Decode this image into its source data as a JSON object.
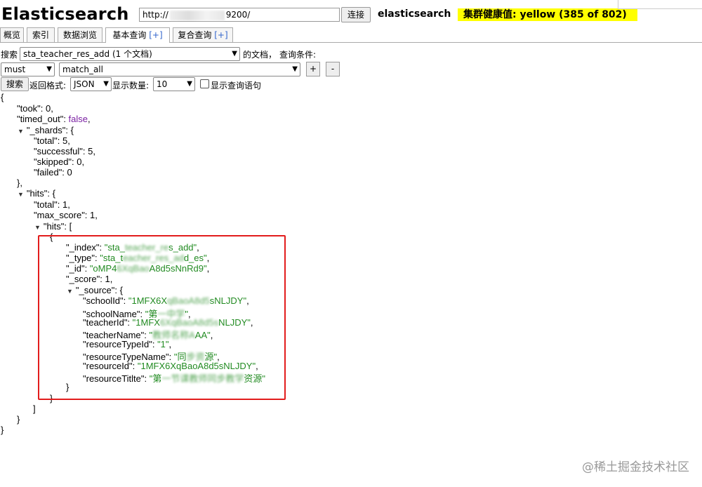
{
  "header": {
    "logo": "Elasticsearch",
    "url_prefix": "http://",
    "url_suffix": "9200/",
    "connect_label": "连接",
    "cluster_name": "elasticsearch",
    "health_text": "集群健康值: yellow (385 of 802)"
  },
  "tabs": [
    {
      "label": "概览"
    },
    {
      "label": "索引"
    },
    {
      "label": "数据浏览"
    },
    {
      "label": "基本查询",
      "plus": "[+]"
    },
    {
      "label": "复合查询",
      "plus": "[+]"
    }
  ],
  "query": {
    "search_label": "搜索",
    "index_value": "sta_teacher_res_add (1 个文档)",
    "docs_label": "的文档，",
    "conditions_label": "查询条件:",
    "bool_value": "must",
    "match_value": "match_all",
    "add_label": "+",
    "remove_label": "-",
    "search_button": "搜索",
    "format_label": "返回格式:",
    "format_value": "JSON",
    "count_label": "显示数量:",
    "count_value": "10",
    "show_query_label": "显示查询语句"
  },
  "result": {
    "took": "0",
    "timed_out": "false",
    "shards": {
      "total": "5",
      "successful": "5",
      "skipped": "0",
      "failed": "0"
    },
    "hits_total": "1",
    "max_score": "1",
    "hit": {
      "index_a": "\"sta_",
      "index_b": "s_add\"",
      "type_a": "\"sta_t",
      "type_b": "d_es\"",
      "id_a": "\"oMP4",
      "id_b": "A8d5sNnRd9\"",
      "score": "1",
      "source": {
        "schoolId_a": "\"1MFX6X",
        "schoolId_b": "sNLJDY\"",
        "schoolName_a": "\"第",
        "schoolName_b": "\"",
        "teacherId_a": "\"1MFX",
        "teacherId_b": "NLJDY\"",
        "teacherName_a": "\"",
        "teacherName_b": "AA\"",
        "resourceTypeId": "\"1\"",
        "resourceTypeName_a": "\"同",
        "resourceTypeName_b": "源\"",
        "resourceId": "\"1MFX6XqBaoA8d5sNLJDY\"",
        "resourceTitlte_a": "\"第",
        "resourceTitlte_b": "资源\""
      }
    }
  },
  "watermark": {
    "site": "@稀土掘金技术社区"
  }
}
